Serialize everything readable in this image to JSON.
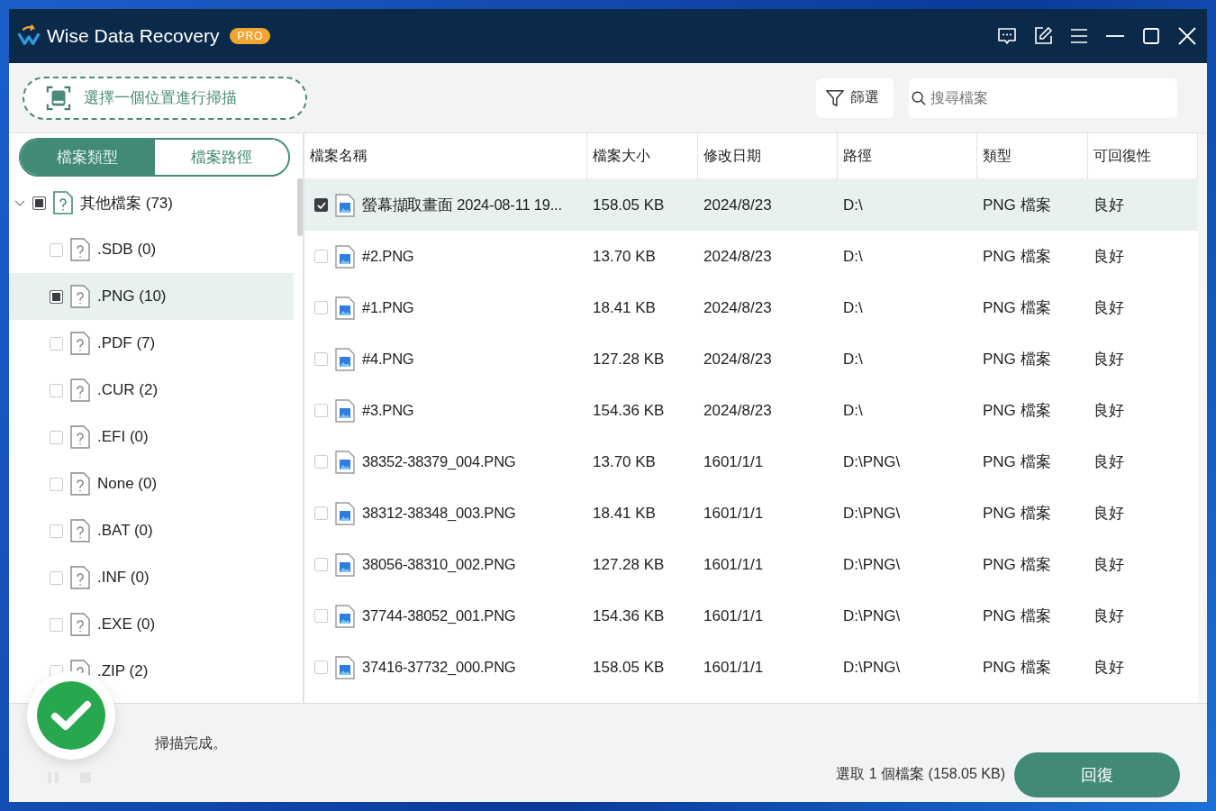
{
  "window": {
    "title": "Wise Data Recovery",
    "badge": "PRO"
  },
  "toolbar": {
    "scan_location": "選擇一個位置進行掃描",
    "filter": "篩選",
    "search": {
      "placeholder": "搜尋檔案"
    }
  },
  "view_tabs": [
    {
      "label": "檔案類型",
      "selected": true
    },
    {
      "label": "檔案路徑",
      "selected": false
    }
  ],
  "tree": [
    {
      "label": "其他檔案 (73)",
      "partial": true,
      "selected": false,
      "expanded": true,
      "children": [
        {
          "label": ".SDB (0)",
          "partial": false,
          "selected": false
        },
        {
          "label": ".PNG (10)",
          "partial": true,
          "selected": true
        },
        {
          "label": ".PDF (7)",
          "partial": false,
          "selected": false
        },
        {
          "label": ".CUR (2)",
          "partial": false,
          "selected": false
        },
        {
          "label": ".EFI (0)",
          "partial": false,
          "selected": false
        },
        {
          "label": "None (0)",
          "partial": false,
          "selected": false
        },
        {
          "label": ".BAT (0)",
          "partial": false,
          "selected": false
        },
        {
          "label": ".INF (0)",
          "partial": false,
          "selected": false
        },
        {
          "label": ".EXE (0)",
          "partial": false,
          "selected": false
        },
        {
          "label": ".ZIP (2)",
          "partial": false,
          "selected": false
        }
      ]
    }
  ],
  "table": {
    "columns": [
      "檔案名稱",
      "檔案大小",
      "修改日期",
      "路徑",
      "類型",
      "可回復性"
    ],
    "rows": [
      {
        "checked": true,
        "selected": true,
        "cells": [
          "螢幕擷取畫面 2024-08-11 19...",
          "158.05 KB",
          "2024/8/23",
          "D:\\",
          "PNG 檔案",
          "良好"
        ]
      },
      {
        "checked": false,
        "selected": false,
        "cells": [
          "#2.PNG",
          "13.70 KB",
          "2024/8/23",
          "D:\\",
          "PNG 檔案",
          "良好"
        ]
      },
      {
        "checked": false,
        "selected": false,
        "cells": [
          "#1.PNG",
          "18.41 KB",
          "2024/8/23",
          "D:\\",
          "PNG 檔案",
          "良好"
        ]
      },
      {
        "checked": false,
        "selected": false,
        "cells": [
          "#4.PNG",
          "127.28 KB",
          "2024/8/23",
          "D:\\",
          "PNG 檔案",
          "良好"
        ]
      },
      {
        "checked": false,
        "selected": false,
        "cells": [
          "#3.PNG",
          "154.36 KB",
          "2024/8/23",
          "D:\\",
          "PNG 檔案",
          "良好"
        ]
      },
      {
        "checked": false,
        "selected": false,
        "cells": [
          "38352-38379_004.PNG",
          "13.70 KB",
          "1601/1/1",
          "D:\\PNG\\",
          "PNG 檔案",
          "良好"
        ]
      },
      {
        "checked": false,
        "selected": false,
        "cells": [
          "38312-38348_003.PNG",
          "18.41 KB",
          "1601/1/1",
          "D:\\PNG\\",
          "PNG 檔案",
          "良好"
        ]
      },
      {
        "checked": false,
        "selected": false,
        "cells": [
          "38056-38310_002.PNG",
          "127.28 KB",
          "1601/1/1",
          "D:\\PNG\\",
          "PNG 檔案",
          "良好"
        ]
      },
      {
        "checked": false,
        "selected": false,
        "cells": [
          "37744-38052_001.PNG",
          "154.36 KB",
          "1601/1/1",
          "D:\\PNG\\",
          "PNG 檔案",
          "良好"
        ]
      },
      {
        "checked": false,
        "selected": false,
        "cells": [
          "37416-37732_000.PNG",
          "158.05 KB",
          "1601/1/1",
          "D:\\PNG\\",
          "PNG 檔案",
          "良好"
        ]
      }
    ]
  },
  "status": {
    "message": "掃描完成。",
    "pause_disabled": true,
    "stop_disabled": true
  },
  "footer": {
    "selection": "選取 1 個檔案 (158.05 KB)",
    "recover": "回復"
  }
}
